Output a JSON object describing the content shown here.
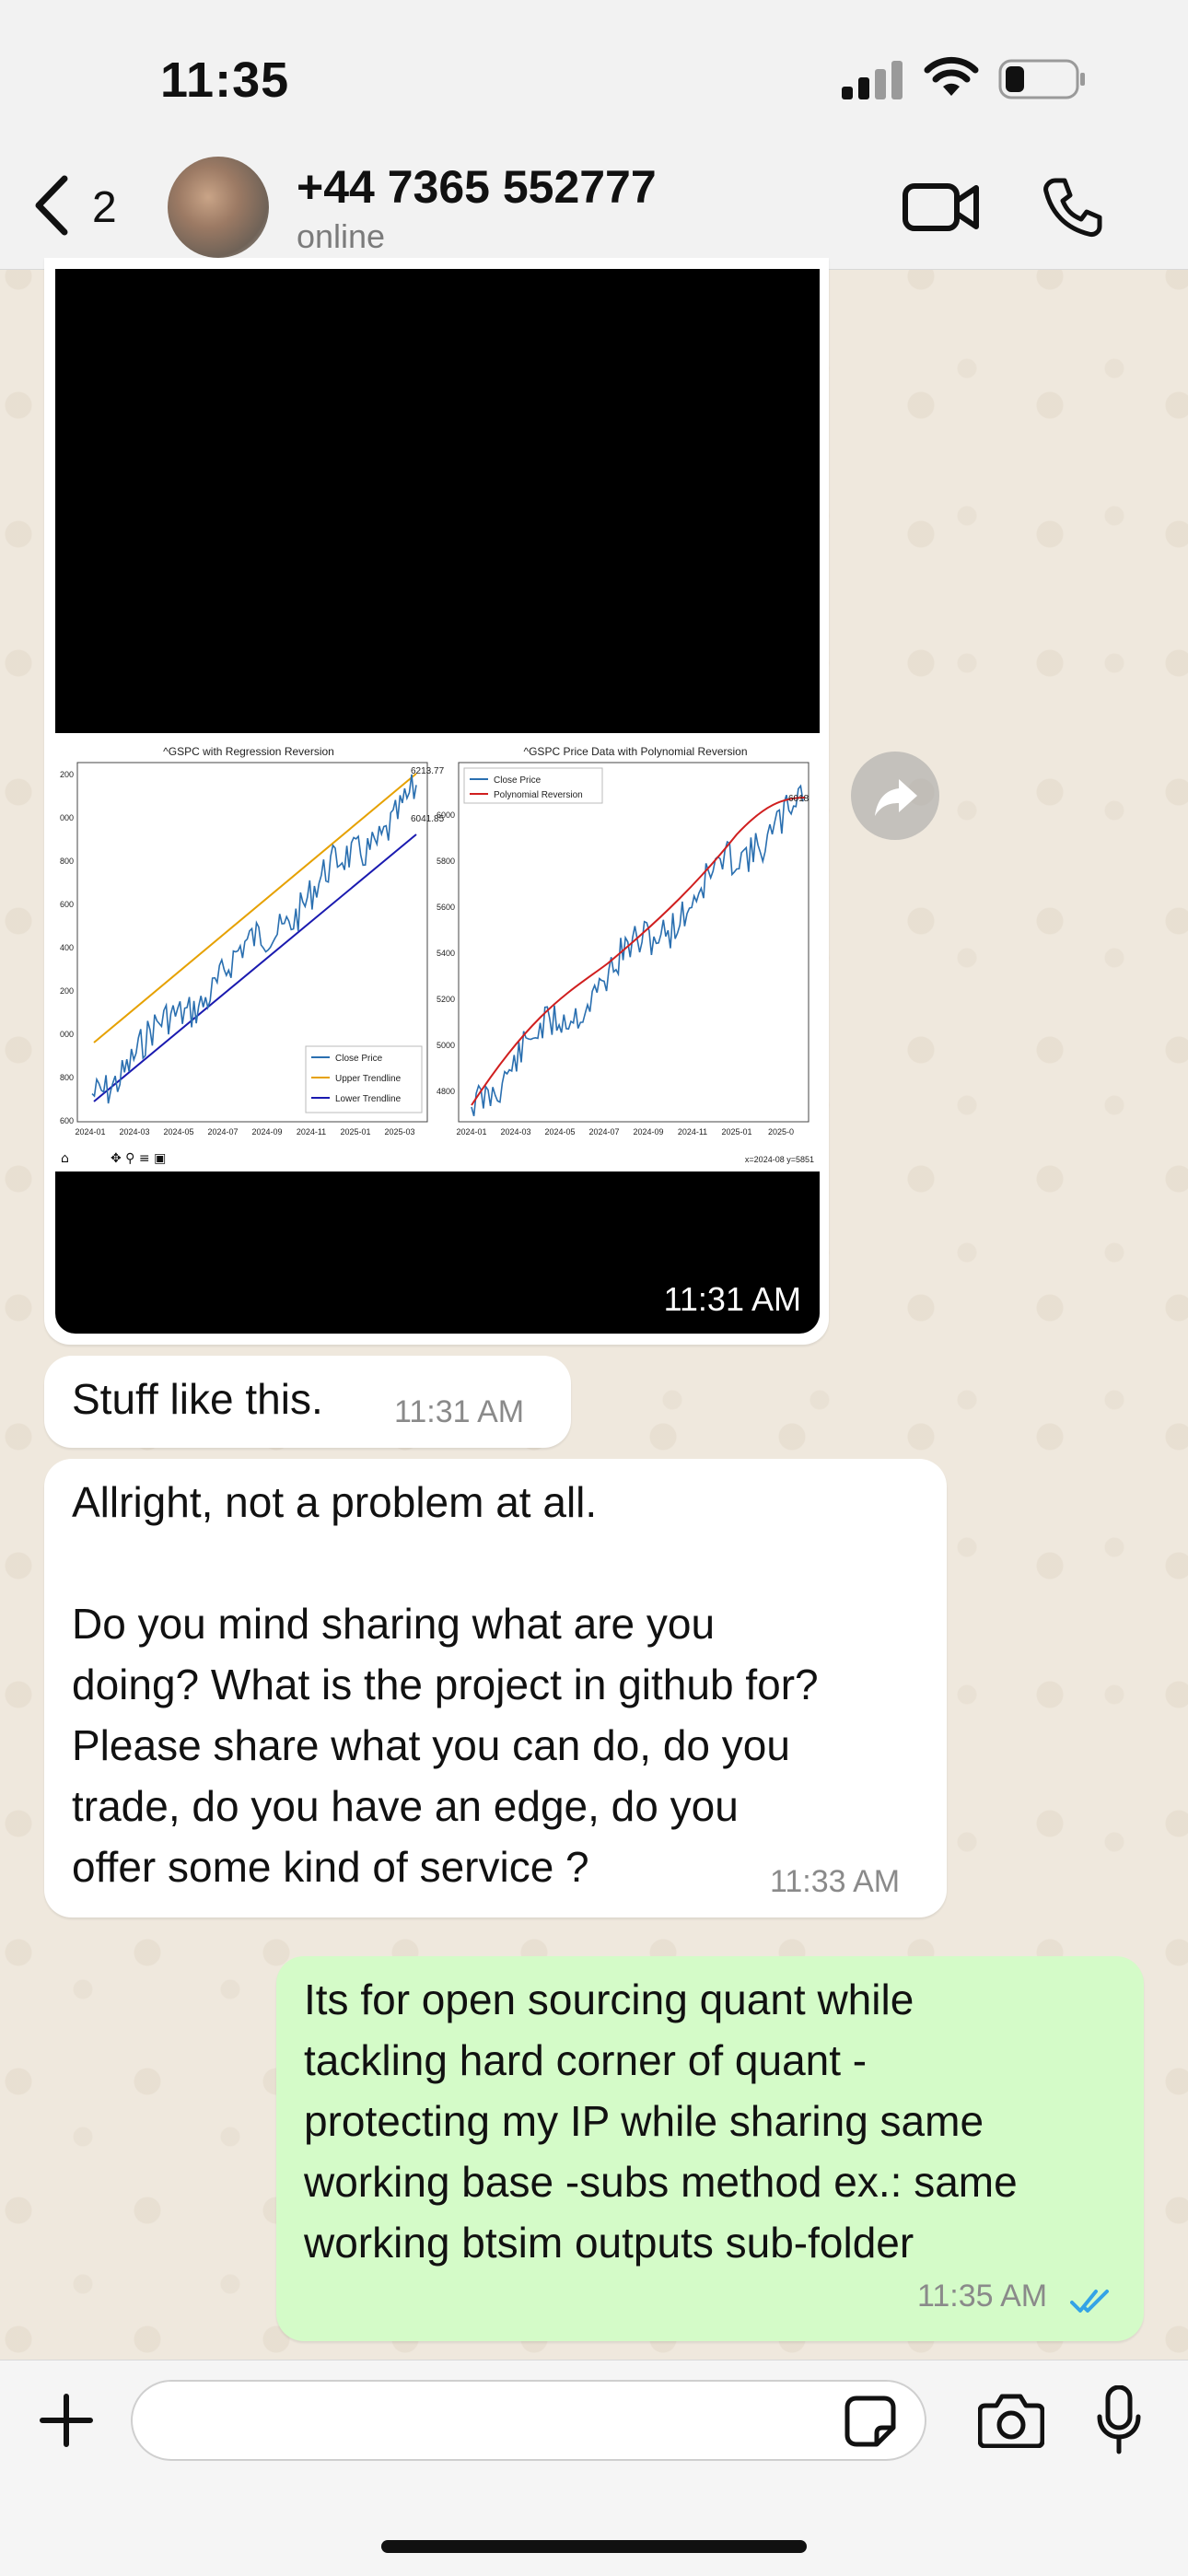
{
  "status_bar": {
    "time": "11:35"
  },
  "header": {
    "back_count": "2",
    "contact_name": "+44 7365 552777",
    "contact_status": "online"
  },
  "messages": [
    {
      "type": "image",
      "direction": "in",
      "time": "11:31 AM",
      "screenshot": {
        "left_title": "^GSPC with Regression Reversion",
        "right_title": "^GSPC Price Data with Polynomial Reversion",
        "left_legend": [
          "Close Price",
          "Upper Trendline",
          "Lower Trendline"
        ],
        "right_legend": [
          "Close Price",
          "Polynomial Reversion"
        ],
        "left_annotations": [
          "6213.77",
          "6041.85"
        ],
        "right_annotation": "6018",
        "x_ticks": [
          "2024-01",
          "2024-03",
          "2024-05",
          "2024-07",
          "2024-09",
          "2024-11",
          "2025-01",
          "2025-03"
        ],
        "right_x_ticks": [
          "2024-01",
          "2024-03",
          "2024-05",
          "2024-07",
          "2024-09",
          "2024-11",
          "2025-01",
          "2025-0"
        ],
        "left_y_ticks": [
          "200",
          "000",
          "800",
          "600",
          "400",
          "200",
          "000",
          "800",
          "600"
        ],
        "right_y_ticks": [
          "6000",
          "5800",
          "5600",
          "5400",
          "5200",
          "5000",
          "4800"
        ],
        "toolbar_status": "x=2024-08 y=5851"
      }
    },
    {
      "type": "text",
      "direction": "in",
      "text": "Stuff like this.",
      "time": "11:31 AM"
    },
    {
      "type": "text",
      "direction": "in",
      "text": "Allright, not a problem at all.\n\nDo you mind sharing what are you\ndoing? What is the project in github for?\nPlease share what you can do, do you\ntrade, do you have an edge, do you\noffer some kind of service ?",
      "time": "11:33 AM"
    },
    {
      "type": "text",
      "direction": "out",
      "text": "Its for open sourcing quant while\ntackling hard corner of quant -\nprotecting my IP while sharing same\nworking base -subs method ex.: same\nworking btsim outputs sub-folder",
      "time": "11:35 AM",
      "read": true
    }
  ],
  "composer": {
    "value": ""
  },
  "colors": {
    "outgoing_bubble": "#d4fbc8",
    "incoming_bubble": "#ffffff",
    "read_ticks": "#34a3e6"
  },
  "icons": [
    "signal-icon",
    "wifi-icon",
    "battery-icon",
    "back-chevron-icon",
    "video-call-icon",
    "phone-icon",
    "forward-icon",
    "plus-icon",
    "sticker-icon",
    "camera-icon",
    "mic-icon",
    "read-ticks-icon"
  ]
}
